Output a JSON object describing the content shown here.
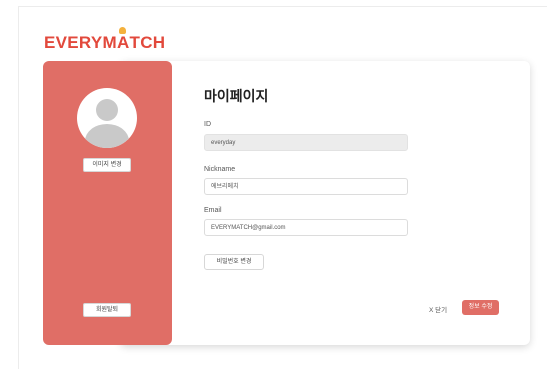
{
  "brand": {
    "logo_prefix": "EVERYM",
    "logo_a": "A",
    "logo_suffix": "TCH",
    "primary_color": "#e2493c",
    "accent_color": "#f4b13c",
    "sidebar_color": "#e06e66"
  },
  "sidebar": {
    "avatar_icon": "user-avatar-icon",
    "change_image_label": "이미지 변경",
    "withdraw_label": "회원탈퇴"
  },
  "main": {
    "title": "마이페이지",
    "fields": {
      "id": {
        "label": "ID",
        "value": "everyday"
      },
      "nickname": {
        "label": "Nickname",
        "value": "에브리메치"
      },
      "email": {
        "label": "Email",
        "value": "EVERYMATCH@gmail.com"
      }
    },
    "change_password_label": "비밀번호 변경",
    "close_label": "X 닫기",
    "save_label": "정보 수정"
  }
}
